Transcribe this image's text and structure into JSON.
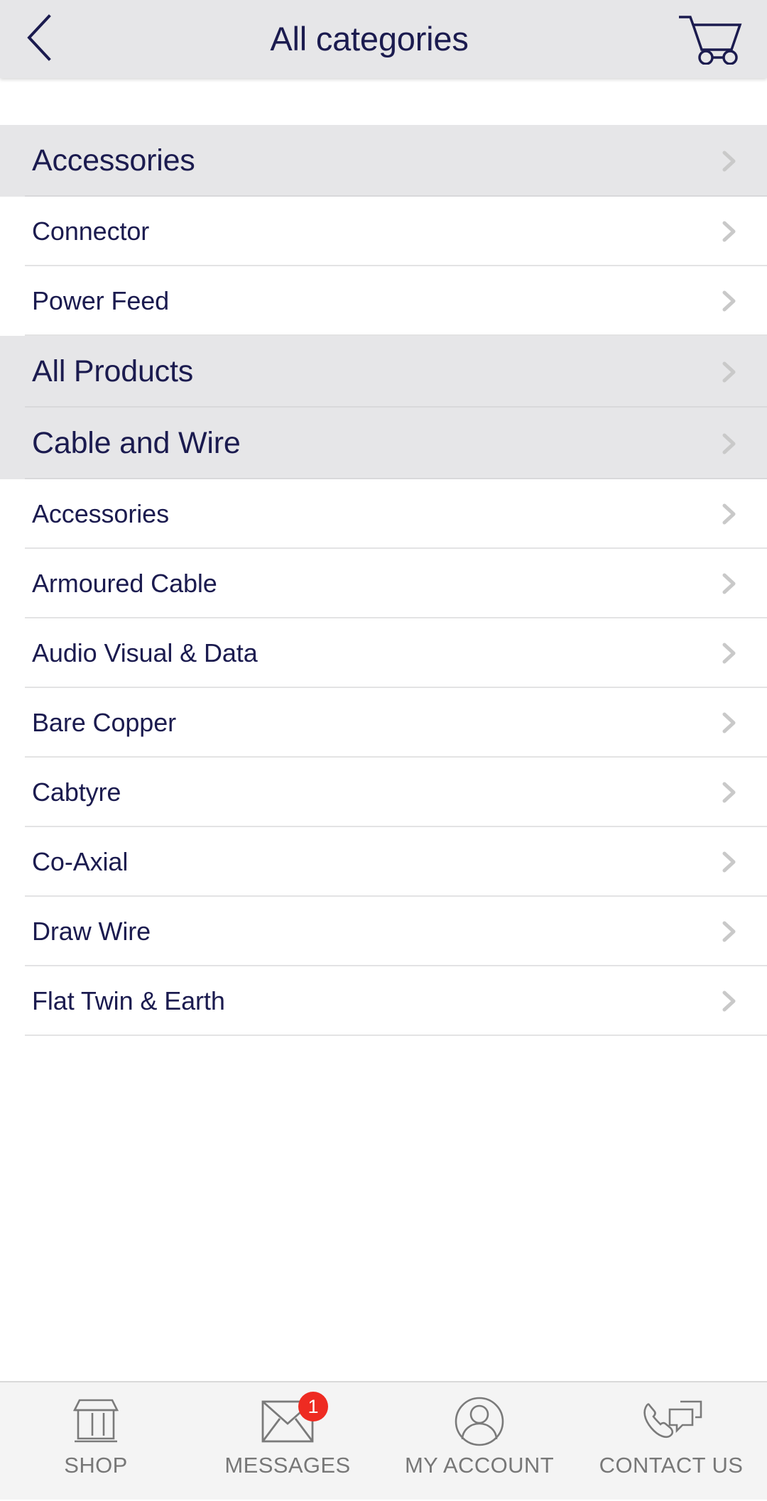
{
  "theme": {
    "header_bg": "#e6e6e8",
    "accent_navy": "#1b1b4f",
    "row_header_bg": "#e6e6e8",
    "row_bg": "#ffffff",
    "divider": "#e3e3e4",
    "chevron": "#c9c9c9",
    "tabbar_bg": "#f4f4f4",
    "tab_label": "#777777",
    "badge_red": "#ee2b22"
  },
  "header": {
    "title": "All categories",
    "back_icon": "chevron-left-icon",
    "cart_icon": "shopping-cart-icon"
  },
  "list": {
    "rows": [
      {
        "label": "Accessories",
        "type": "parent",
        "icon": "chevron-right-icon"
      },
      {
        "label": "Connector",
        "type": "child",
        "icon": "chevron-right-icon"
      },
      {
        "label": "Power Feed",
        "type": "child",
        "icon": "chevron-right-icon"
      },
      {
        "label": "All Products",
        "type": "parent",
        "icon": "chevron-right-icon"
      },
      {
        "label": "Cable and Wire",
        "type": "parent",
        "icon": "chevron-right-icon"
      },
      {
        "label": "Accessories",
        "type": "child",
        "icon": "chevron-right-icon"
      },
      {
        "label": "Armoured Cable",
        "type": "child",
        "icon": "chevron-right-icon"
      },
      {
        "label": "Audio Visual & Data",
        "type": "child",
        "icon": "chevron-right-icon"
      },
      {
        "label": "Bare Copper",
        "type": "child",
        "icon": "chevron-right-icon"
      },
      {
        "label": "Cabtyre",
        "type": "child",
        "icon": "chevron-right-icon"
      },
      {
        "label": "Co-Axial",
        "type": "child",
        "icon": "chevron-right-icon"
      },
      {
        "label": "Draw Wire",
        "type": "child",
        "icon": "chevron-right-icon"
      },
      {
        "label": "Flat Twin & Earth",
        "type": "child",
        "icon": "chevron-right-icon"
      }
    ]
  },
  "tabbar": {
    "tabs": [
      {
        "label": "SHOP",
        "icon": "storefront-icon",
        "badge": ""
      },
      {
        "label": "MESSAGES",
        "icon": "envelope-icon",
        "badge": "1"
      },
      {
        "label": "MY ACCOUNT",
        "icon": "person-circle-icon",
        "badge": ""
      },
      {
        "label": "CONTACT US",
        "icon": "phone-chat-icon",
        "badge": ""
      }
    ]
  }
}
